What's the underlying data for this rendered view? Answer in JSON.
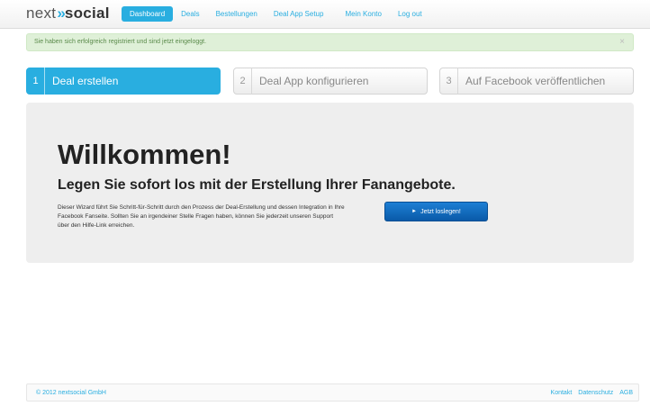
{
  "brand": {
    "next": "next",
    "arrows": "»",
    "social": "social"
  },
  "nav": {
    "items": [
      {
        "label": "Dashboard",
        "active": true
      },
      {
        "label": "Deals",
        "active": false
      },
      {
        "label": "Bestellungen",
        "active": false
      },
      {
        "label": "Deal App Setup",
        "active": false
      },
      {
        "label": "Mein Konto",
        "active": false
      },
      {
        "label": "Log out",
        "active": false
      }
    ]
  },
  "alert": {
    "message": "Sie haben sich erfolgreich registriert und sind jetzt eingeloggt.",
    "close": "×"
  },
  "steps": [
    {
      "num": "1",
      "label": "Deal erstellen",
      "active": true
    },
    {
      "num": "2",
      "label": "Deal App konfigurieren",
      "active": false
    },
    {
      "num": "3",
      "label": "Auf Facebook veröffentlichen",
      "active": false
    }
  ],
  "hero": {
    "title": "Willkommen!",
    "subtitle": "Legen Sie sofort los mit der Erstellung Ihrer Fanangebote.",
    "text": "Dieser Wizard führt Sie Schritt-für-Schritt durch den Prozess der Deal-Erstellung und dessen Integration in Ihre Facebook Fanseite. Sollten Sie an irgendeiner Stelle Fragen haben, können Sie jederzeit unseren Support über den Hilfe-Link erreichen.",
    "cta_icon": "►",
    "cta_label": "Jetzt loslegen!"
  },
  "footer": {
    "copyright": "© 2012 nextsocial GmbH",
    "links": [
      "Kontakt",
      "Datenschutz",
      "AGB"
    ]
  },
  "colors": {
    "accent": "#29aee0",
    "cta": "#0a5aa8",
    "alert_bg": "#dff0d8",
    "hero_bg": "#eeeeee"
  }
}
